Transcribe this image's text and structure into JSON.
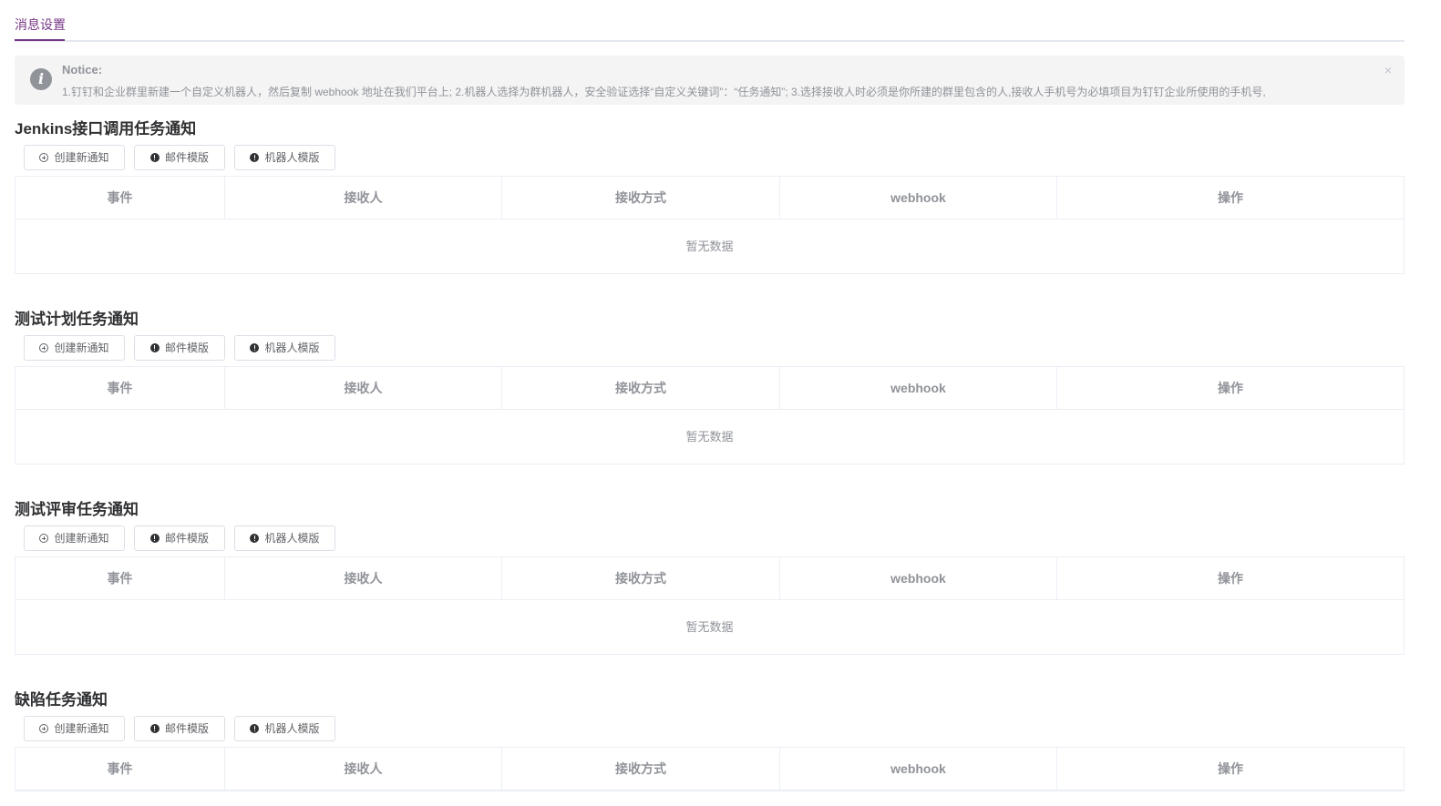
{
  "tabs": [
    {
      "label": "消息设置",
      "active": true
    }
  ],
  "notice": {
    "title": "Notice:",
    "text": "1.钉钉和企业群里新建一个自定义机器人，然后复制 webhook 地址在我们平台上; 2.机器人选择为群机器人，安全验证选择“自定义关键词”：“任务通知”; 3.选择接收人时必须是你所建的群里包含的人,接收人手机号为必填项目为钉钉企业所使用的手机号,",
    "close": "×",
    "icon": "info-icon"
  },
  "buttons": {
    "create": "创建新通知",
    "mail_template": "邮件模版",
    "robot_template": "机器人模版"
  },
  "columns": [
    "事件",
    "接收人",
    "接收方式",
    "webhook",
    "操作"
  ],
  "empty_text": "暂无数据",
  "sections": [
    {
      "title": "Jenkins接口调用任务通知"
    },
    {
      "title": "测试计划任务通知"
    },
    {
      "title": "测试评审任务通知"
    },
    {
      "title": "缺陷任务通知"
    }
  ],
  "colors": {
    "accent": "#783887",
    "notice_bg": "#f4f4f5",
    "muted_text": "#909399",
    "border": "#ebeef5"
  }
}
